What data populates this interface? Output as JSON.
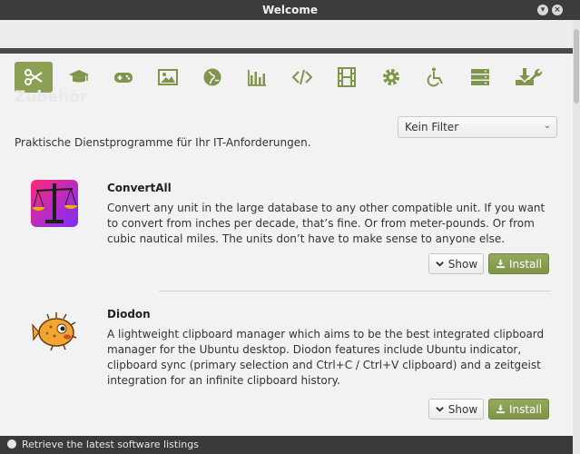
{
  "window": {
    "title": "Welcome"
  },
  "section": {
    "title": "Zubehör",
    "subtitle": "Praktische Dienstprogramme für Ihr IT-Anforderungen.",
    "filter_value": "Kein Filter"
  },
  "categories": [
    {
      "icon": "scissors-icon",
      "active": true
    },
    {
      "icon": "graduation-cap-icon"
    },
    {
      "icon": "gamepad-icon"
    },
    {
      "icon": "image-icon"
    },
    {
      "icon": "globe-icon"
    },
    {
      "icon": "bar-chart-icon"
    },
    {
      "icon": "code-icon"
    },
    {
      "icon": "film-icon"
    },
    {
      "icon": "gear-icon"
    },
    {
      "icon": "wheelchair-icon"
    },
    {
      "icon": "server-icon"
    },
    {
      "icon": "download-icon"
    },
    {
      "icon": "wrench-icon"
    }
  ],
  "apps": [
    {
      "name": "ConvertAll",
      "description": "Convert any unit in the large database to any other compatible unit. If you want to convert from inches per decade, that’s fine. Or from meter-pounds. Or from cubic nautical miles. The units don’t have to make sense to anyone else.",
      "show_label": "Show",
      "install_label": "Install"
    },
    {
      "name": "Diodon",
      "description": "A lightweight clipboard manager which aims to be the best integrated clipboard manager for the Ubuntu desktop. Diodon features include Ubuntu indicator, clipboard sync (primary selection and Ctrl+C / Ctrl+V clipboard) and a zeitgeist integration for an infinite clipboard history.",
      "show_label": "Show",
      "install_label": "Install"
    }
  ],
  "status": {
    "message": "Retrieve the latest software listings"
  },
  "colors": {
    "accent": "#8ba054",
    "titlebar": "#3c3c3c",
    "background": "#f2f2f2"
  }
}
